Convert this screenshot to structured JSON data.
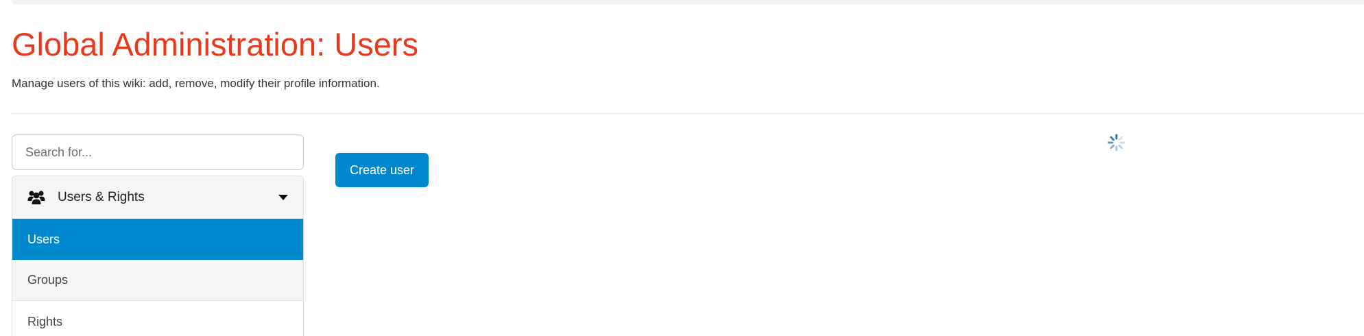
{
  "header": {
    "title": "Global Administration: Users",
    "description": "Manage users of this wiki: add, remove, modify their profile information."
  },
  "sidebar": {
    "search": {
      "placeholder": "Search for...",
      "value": ""
    },
    "category": {
      "label": "Users & Rights",
      "icon": "users-icon"
    },
    "items": [
      {
        "label": "Users",
        "active": true
      },
      {
        "label": "Groups",
        "active": false
      },
      {
        "label": "Rights",
        "active": false
      }
    ]
  },
  "main": {
    "create_button_label": "Create user",
    "loading_icon": "spinner-icon"
  },
  "colors": {
    "title": "#e8391e",
    "accent": "#0088cc"
  }
}
